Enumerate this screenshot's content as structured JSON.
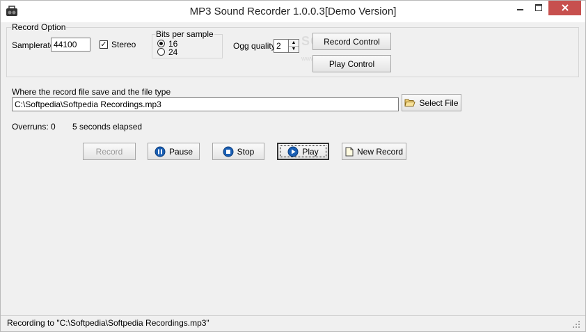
{
  "window": {
    "title": "MP3 Sound Recorder 1.0.0.3[Demo Version]"
  },
  "record_option": {
    "legend": "Record Option",
    "samplerate_label": "Samplerate",
    "samplerate_value": "44100",
    "stereo_label": "Stereo",
    "stereo_checked": true,
    "bits": {
      "legend": "Bits per sample",
      "options": [
        "16",
        "24"
      ],
      "selected": "16"
    },
    "ogg_quality_label": "Ogg quality",
    "ogg_quality_value": "2",
    "record_control_label": "Record Control",
    "play_control_label": "Play Control"
  },
  "file": {
    "label": "Where the record file save and the file type",
    "path_value": "C:\\Softpedia\\Softpedia Recordings.mp3",
    "select_file_label": "Select File"
  },
  "info": {
    "overruns_label": "Overruns:",
    "overruns_value": "0",
    "elapsed": "5 seconds elapsed"
  },
  "controls": {
    "record": "Record",
    "pause": "Pause",
    "stop": "Stop",
    "play": "Play",
    "new_record": "New Record"
  },
  "status": {
    "text": "Recording to \"C:\\Softpedia\\Softpedia Recordings.mp3\""
  },
  "watermark": {
    "text": "SOFTPEDIA",
    "sub": "www.softpedia.com"
  },
  "colors": {
    "close_button": "#c7504e",
    "media_icon_blue": "#1a5fb4"
  }
}
